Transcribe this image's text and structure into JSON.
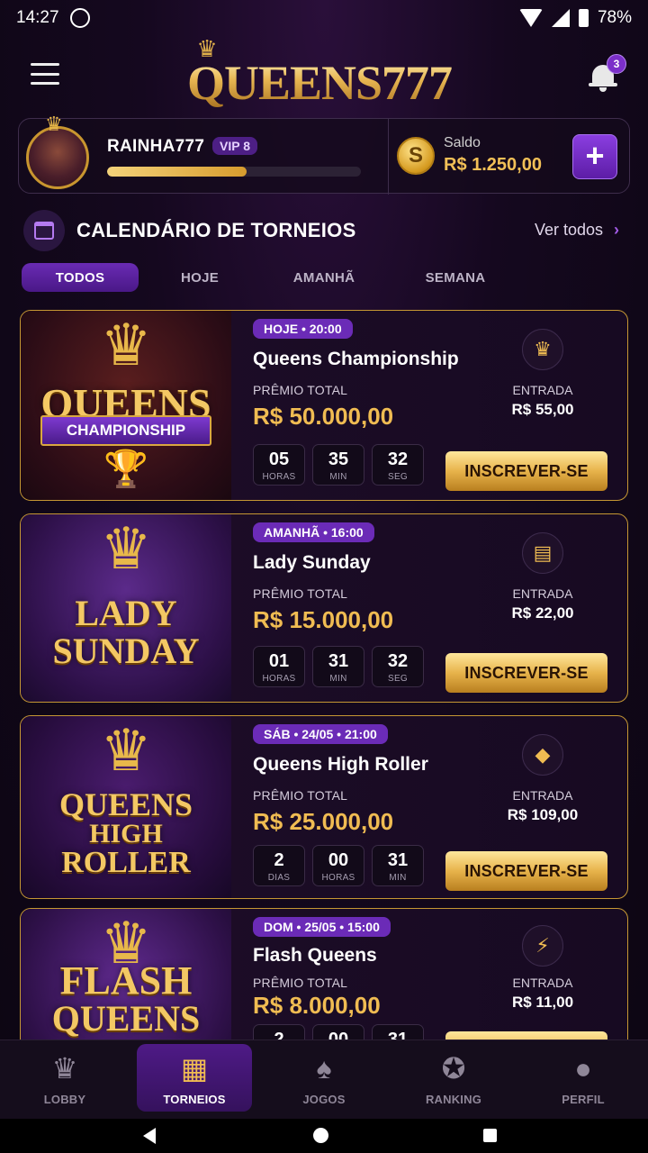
{
  "status_bar": {
    "time": "14:27",
    "battery": "78%"
  },
  "header": {
    "logo": "QUEENS777",
    "notifications_count": "3"
  },
  "profile": {
    "username": "RAINHA777",
    "vip": "VIP 8",
    "xp_progress": 0.55,
    "saldo_label": "Saldo",
    "saldo_value": "R$ 1.250,00",
    "add_label": "+"
  },
  "section": {
    "title": "CALENDÁRIO DE TORNEIOS",
    "see_all": "Ver todos"
  },
  "tabs": [
    {
      "label": "TODOS",
      "active": true
    },
    {
      "label": "HOJE"
    },
    {
      "label": "AMANHÃ"
    },
    {
      "label": "SEMANA"
    }
  ],
  "tournaments": [
    {
      "image_title": [
        "QUEENS"
      ],
      "image_ribbon": "CHAMPIONSHIP",
      "date": "HOJE • 20:00",
      "name": "Queens Championship",
      "prize_label": "PRÊMIO TOTAL",
      "prize": "R$ 50.000,00",
      "timer": [
        {
          "value": "05",
          "unit": "HORAS"
        },
        {
          "value": "35",
          "unit": "MIN"
        },
        {
          "value": "32",
          "unit": "SEG"
        }
      ],
      "entry_icon": "crown-icon",
      "entry_label": "ENTRADA",
      "entry": "R$ 55,00",
      "button": "INSCREVER-SE"
    },
    {
      "image_title": [
        "LADY",
        "SUNDAY"
      ],
      "image_ribbon": "",
      "date": "AMANHÃ • 16:00",
      "name": "Lady Sunday",
      "prize_label": "PRÊMIO TOTAL",
      "prize": "R$ 15.000,00",
      "timer": [
        {
          "value": "01",
          "unit": "HORAS"
        },
        {
          "value": "31",
          "unit": "MIN"
        },
        {
          "value": "32",
          "unit": "SEG"
        }
      ],
      "entry_icon": "ticket-icon",
      "entry_label": "ENTRADA",
      "entry": "R$ 22,00",
      "button": "INSCREVER-SE"
    },
    {
      "image_title": [
        "QUEENS",
        "HIGH",
        "ROLLER"
      ],
      "image_ribbon": "",
      "date": "SÁB • 24/05 • 21:00",
      "name": "Queens High Roller",
      "prize_label": "PRÊMIO TOTAL",
      "prize": "R$ 25.000,00",
      "timer": [
        {
          "value": "2",
          "unit": "DIAS"
        },
        {
          "value": "00",
          "unit": "HORAS"
        },
        {
          "value": "31",
          "unit": "MIN"
        }
      ],
      "entry_icon": "diamond-icon",
      "entry_label": "ENTRADA",
      "entry": "R$ 109,00",
      "button": "INSCREVER-SE"
    },
    {
      "image_title": [
        "FLASH",
        "QUEENS"
      ],
      "image_ribbon": "",
      "date": "DOM • 25/05 • 15:00",
      "name": "Flash Queens",
      "prize_label": "PRÊMIO TOTAL",
      "prize": "R$ 8.000,00",
      "timer": [
        {
          "value": "2",
          "unit": ""
        },
        {
          "value": "00",
          "unit": ""
        },
        {
          "value": "31",
          "unit": ""
        }
      ],
      "entry_icon": "lightning-icon",
      "entry_label": "ENTRADA",
      "entry": "R$ 11,00",
      "button": ""
    }
  ],
  "bottom_nav": [
    {
      "label": "LOBBY",
      "icon": "crown-icon"
    },
    {
      "label": "TORNEIOS",
      "icon": "calendar-icon",
      "active": true
    },
    {
      "label": "JOGOS",
      "icon": "cards-icon"
    },
    {
      "label": "RANKING",
      "icon": "medal-icon"
    },
    {
      "label": "PERFIL",
      "icon": "user-icon"
    }
  ],
  "colors": {
    "accent": "#6b2bb7",
    "gold": "#f0bc52",
    "border_gold": "#c59733",
    "background": "#15081f"
  }
}
